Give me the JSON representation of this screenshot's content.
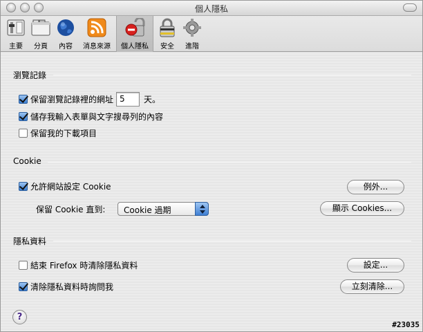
{
  "window": {
    "title": "個人隱私"
  },
  "toolbar": {
    "items": [
      {
        "label": "主要",
        "icon": "main-switch-icon"
      },
      {
        "label": "分頁",
        "icon": "tabs-icon"
      },
      {
        "label": "內容",
        "icon": "globe-icon"
      },
      {
        "label": "消息來源",
        "icon": "rss-feed-icon"
      },
      {
        "label": "個人隱私",
        "icon": "privacy-lock-icon",
        "selected": true
      },
      {
        "label": "安全",
        "icon": "security-padlock-icon"
      },
      {
        "label": "進階",
        "icon": "gear-icon"
      }
    ]
  },
  "history": {
    "title": "瀏覽記錄",
    "keep_history_label": "保留瀏覽記錄裡的網址",
    "keep_history_days": "5",
    "days_unit": "天。",
    "keep_history_checked": true,
    "save_form_label": "儲存我輸入表單與文字搜尋列的內容",
    "save_form_checked": true,
    "keep_downloads_label": "保留我的下載項目",
    "keep_downloads_checked": false
  },
  "cookie": {
    "title": "Cookie",
    "allow_label": "允許網站設定 Cookie",
    "allow_checked": true,
    "exceptions_button": "例外...",
    "keep_until_label": "保留 Cookie 直到:",
    "keep_until_value": "Cookie 過期",
    "show_cookies_button": "顯示 Cookies..."
  },
  "private_data": {
    "title": "隱私資料",
    "clear_on_exit_label": "結束 Firefox 時清除隱私資料",
    "clear_on_exit_checked": false,
    "settings_button": "設定...",
    "ask_label": "清除隱私資料時詢問我",
    "ask_checked": true,
    "clear_now_button": "立刻清除..."
  },
  "help": {
    "label": "?"
  },
  "badge": "#23035"
}
